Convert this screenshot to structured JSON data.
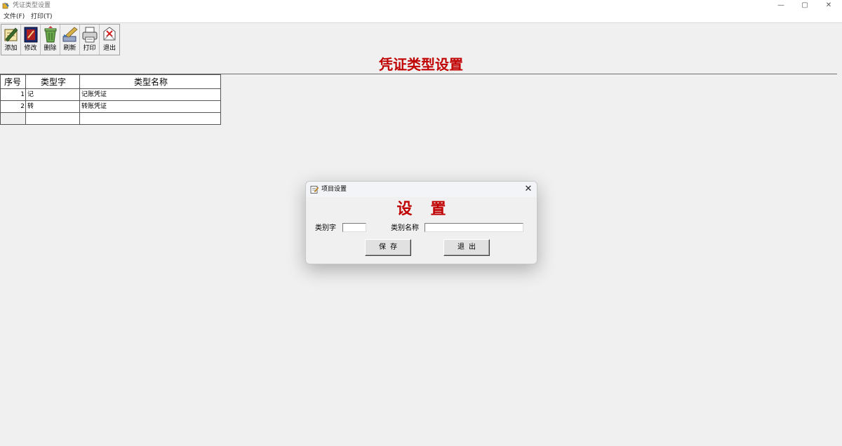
{
  "window": {
    "title": "凭证类型设置",
    "controls": {
      "minimize": "—",
      "restore": "▢",
      "close": "✕"
    }
  },
  "menu": [
    {
      "label": "文件(F)"
    },
    {
      "label": "打印(T)"
    }
  ],
  "toolbar": [
    {
      "label": "添加",
      "icon": "add-icon"
    },
    {
      "label": "修改",
      "icon": "edit-icon"
    },
    {
      "label": "删除",
      "icon": "delete-icon"
    },
    {
      "label": "刷新",
      "icon": "refresh-icon"
    },
    {
      "label": "打印",
      "icon": "print-icon"
    },
    {
      "label": "退出",
      "icon": "exit-icon"
    }
  ],
  "page": {
    "title": "凭证类型设置"
  },
  "grid": {
    "headers": [
      "序号",
      "类型字",
      "类型名称"
    ],
    "rows": [
      {
        "index": "1",
        "code": "记",
        "name": "记账凭证"
      },
      {
        "index": "2",
        "code": "转",
        "name": "转账凭证"
      },
      {
        "index": "",
        "code": "",
        "name": ""
      }
    ]
  },
  "dialog": {
    "title": "项目设置",
    "heading": "设置",
    "close": "✕",
    "fields": {
      "code_label": "类别字",
      "code_value": "",
      "name_label": "类别名称",
      "name_value": ""
    },
    "buttons": {
      "save": "保存",
      "exit": "退出"
    }
  },
  "colors": {
    "title_red": "#c00000",
    "background": "#f0f0f0"
  }
}
